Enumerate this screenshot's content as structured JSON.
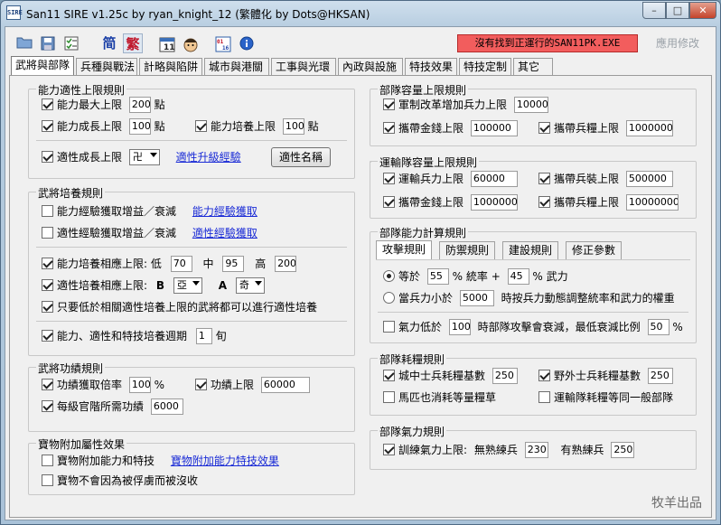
{
  "window": {
    "title": "San11 SIRE v1.25c by ryan_knight_12 (繁體化 by Dots@HKSAN)",
    "icon_text": "SIRE"
  },
  "toolbar": {
    "simplified_label": "简",
    "traditional_label": "繁",
    "status_text": "沒有找到正運行的SAN11PK.EXE",
    "apply_label": "應用修改",
    "status_color": "#f25d5d"
  },
  "tabs": [
    {
      "label": "武將與部隊"
    },
    {
      "label": "兵種與戰法"
    },
    {
      "label": "計略與陷阱"
    },
    {
      "label": "城市與港關"
    },
    {
      "label": "工事與光環"
    },
    {
      "label": "內政與設施"
    },
    {
      "label": "特技效果"
    },
    {
      "label": "特技定制"
    },
    {
      "label": "其它"
    }
  ],
  "left": {
    "ability": {
      "title": "能力適性上限規則",
      "max_label": "能力最大上限",
      "max_value": "200",
      "max_unit": "點",
      "growth_label": "能力成長上限",
      "growth_value": "100",
      "growth_unit": "點",
      "train_label": "能力培養上限",
      "train_value": "100",
      "train_unit": "點",
      "apt_label": "適性成長上限",
      "apt_value": "卍",
      "apt_link": "適性升級經驗",
      "apt_name_btn": "適性名稱"
    },
    "cultivate": {
      "title": "武將培養規則",
      "r1_label": "能力經驗獲取增益／衰減",
      "r1_link": "能力經驗獲取",
      "r2_label": "適性經驗獲取增益／衰減",
      "r2_link": "適性經驗獲取",
      "r3_label": "能力培養相應上限:",
      "low": "低",
      "low_value": "70",
      "mid": "中",
      "mid_value": "95",
      "high": "高",
      "high_value": "200",
      "r4_label": "適性培養相應上限:",
      "b_label": "B",
      "b_value": "亞",
      "a_label": "A",
      "a_value": "奇",
      "r5_label": "只要低於相關適性培養上限的武將都可以進行適性培養",
      "r6_label": "能力、適性和特技培養週期",
      "r6_value": "1",
      "r6_unit": "旬"
    },
    "merit": {
      "title": "武將功績規則",
      "rate_label": "功績獲取倍率",
      "rate_value": "100",
      "rate_unit": "%",
      "cap_label": "功績上限",
      "cap_value": "60000",
      "rank_label": "每級官階所需功績",
      "rank_value": "6000"
    },
    "treasure": {
      "title": "寶物附加屬性效果",
      "t1_label": "寶物附加能力和特技",
      "t1_link": "寶物附加能力特技效果",
      "t2_label": "寶物不會因為被俘虜而被沒收"
    }
  },
  "right": {
    "capacity": {
      "title": "部隊容量上限規則",
      "c1_label": "軍制改革增加兵力上限",
      "c1_value": "10000",
      "c2_label": "攜帶金錢上限",
      "c2_value": "100000",
      "c3_label": "攜帶兵糧上限",
      "c3_value": "1000000"
    },
    "transport": {
      "title": "運輸隊容量上限規則",
      "t1_label": "運輸兵力上限",
      "t1_value": "60000",
      "t2_label": "攜帶兵裝上限",
      "t2_value": "500000",
      "t3_label": "攜帶金錢上限",
      "t3_value": "1000000",
      "t4_label": "攜帶兵糧上限",
      "t4_value": "10000000"
    },
    "calc": {
      "title": "部隊能力計算規則",
      "subtabs": [
        "攻擊規則",
        "防禦規則",
        "建設規則",
        "修正參數"
      ],
      "eq_prefix": "等於",
      "eq_value1": "55",
      "eq_mid": "% 統率 +",
      "eq_value2": "45",
      "eq_suffix": "% 武力",
      "lt_prefix": "當兵力小於",
      "lt_value": "5000",
      "lt_suffix": "時按兵力動態調整統率和武力的權重",
      "morale_prefix": "氣力低於",
      "morale_value": "100",
      "morale_mid": "時部隊攻擊會衰減，最低衰減比例",
      "morale_value2": "50",
      "morale_unit": "%"
    },
    "consume": {
      "title": "部隊耗糧規則",
      "c1_label": "城中士兵耗糧基數",
      "c1_value": "250",
      "c2_label": "野外士兵耗糧基數",
      "c2_value": "250",
      "c3_label": "馬匹也消耗等量糧草",
      "c4_label": "運輸隊耗糧等同一般部隊"
    },
    "morale": {
      "title": "部隊氣力規則",
      "m_label": "訓練氣力上限:",
      "unskilled": "無熟練兵",
      "unskilled_value": "230",
      "skilled": "有熟練兵",
      "skilled_value": "250"
    }
  },
  "watermark": "牧羊出品"
}
